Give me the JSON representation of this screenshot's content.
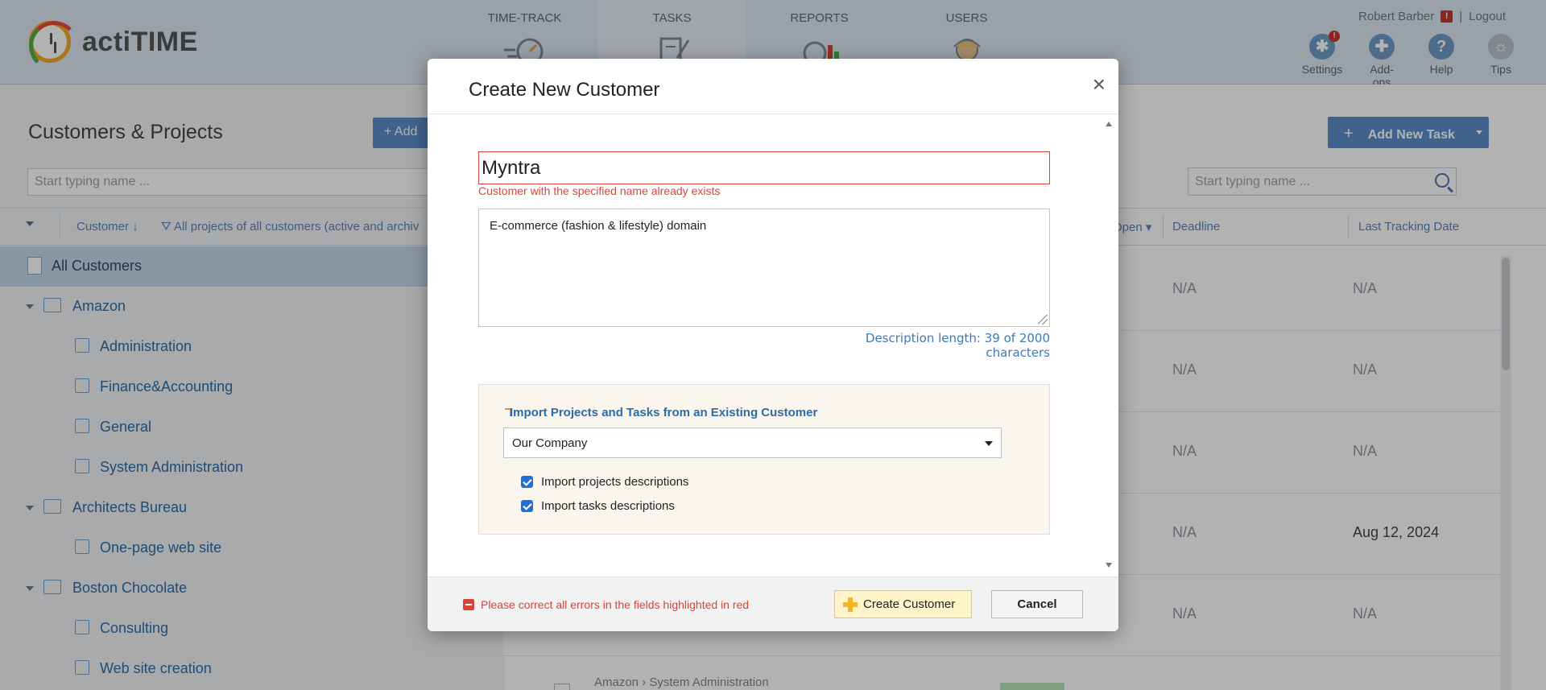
{
  "app": {
    "logo_text": "actiTIME",
    "nav": [
      {
        "label": "TIME-TRACK",
        "icon": "stopwatch-icon"
      },
      {
        "label": "TASKS",
        "icon": "clipboard-icon"
      },
      {
        "label": "REPORTS",
        "icon": "chart-icon"
      },
      {
        "label": "USERS",
        "icon": "users-icon"
      }
    ],
    "active_nav": "TASKS",
    "user_name": "Robert Barber",
    "alert_badge": "!",
    "separator": "|",
    "logout": "Logout",
    "tools": [
      {
        "label": "Settings",
        "icon": "gear-icon",
        "badge": "!"
      },
      {
        "label": "Add-ons",
        "icon": "puzzle-icon"
      },
      {
        "label": "Help",
        "icon": "help-icon"
      },
      {
        "label": "Tips",
        "icon": "lightbulb-icon"
      }
    ]
  },
  "left": {
    "title": "Customers & Projects",
    "add_button": "+ Add",
    "search_placeholder": "Start typing name ...",
    "header": {
      "customer": "Customer",
      "filter": "All projects of all customers (active and archiv"
    },
    "tree": [
      {
        "label": "All Customers",
        "level": 0,
        "type": "all",
        "selected": true
      },
      {
        "label": "Amazon",
        "level": 0,
        "type": "customer"
      },
      {
        "label": "Administration",
        "level": 1,
        "type": "project"
      },
      {
        "label": "Finance&Accounting",
        "level": 1,
        "type": "project"
      },
      {
        "label": "General",
        "level": 1,
        "type": "project"
      },
      {
        "label": "System Administration",
        "level": 1,
        "type": "project"
      },
      {
        "label": "Architects Bureau",
        "level": 0,
        "type": "customer"
      },
      {
        "label": "One-page web site",
        "level": 1,
        "type": "project"
      },
      {
        "label": "Boston Chocolate",
        "level": 0,
        "type": "customer"
      },
      {
        "label": "Consulting",
        "level": 1,
        "type": "project"
      },
      {
        "label": "Web site creation",
        "level": 1,
        "type": "project"
      }
    ]
  },
  "right": {
    "add_task_label": "Add New Task",
    "add_task_plus": "+",
    "search_placeholder": "Start typing name ...",
    "header": {
      "open": "Open",
      "deadline": "Deadline",
      "last_tracking": "Last Tracking Date"
    },
    "rows": [
      {
        "deadline": "N/A",
        "last": "N/A"
      },
      {
        "deadline": "N/A",
        "last": "N/A"
      },
      {
        "deadline": "N/A",
        "last": "N/A"
      },
      {
        "deadline": "N/A",
        "last": "Aug 12, 2024"
      },
      {
        "deadline": "N/A",
        "last": "N/A"
      }
    ],
    "partial_row": "Amazon › System Administration"
  },
  "modal": {
    "title": "Create New Customer",
    "close": "×",
    "name_value": "Myntra",
    "name_error": "Customer with the specified name already exists",
    "description": "E-commerce (fashion & lifestyle) domain",
    "description_length": "Description length: 39 of 2000 characters",
    "import_title": "Import Projects and Tasks from an Existing Customer",
    "import_select": "Our Company",
    "import_projects_desc": "Import projects descriptions",
    "import_tasks_desc": "Import tasks descriptions",
    "footer_error": "Please correct all errors in the fields highlighted in red",
    "create_label": "Create Customer",
    "cancel_label": "Cancel"
  }
}
